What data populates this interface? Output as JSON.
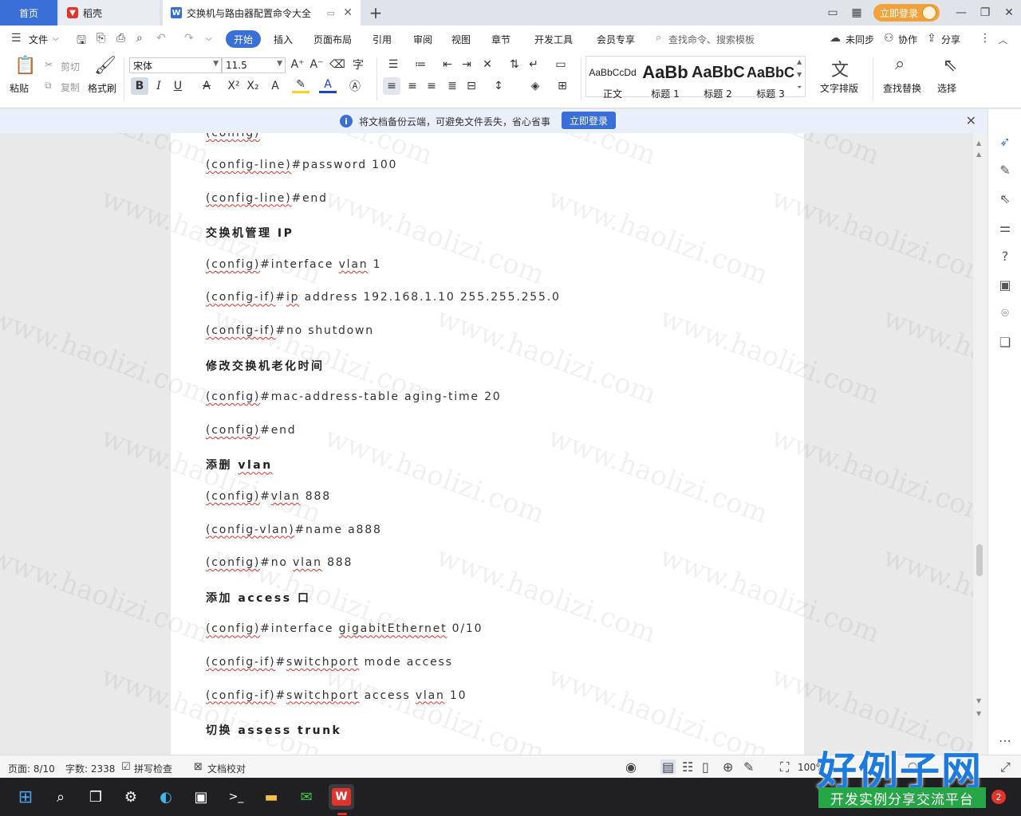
{
  "tabs": [
    {
      "label": "首页"
    },
    {
      "label": "稻壳"
    },
    {
      "label": "交换机与路由器配置命令大全"
    }
  ],
  "window": {
    "login_label": "立即登录"
  },
  "menu": {
    "file": "文件",
    "items": [
      "开始",
      "插入",
      "页面布局",
      "引用",
      "审阅",
      "视图",
      "章节",
      "开发工具",
      "会员专享"
    ],
    "search_placeholder": "查找命令、搜索模板",
    "unsynced": "未同步",
    "collab": "协作",
    "share": "分享"
  },
  "ribbon": {
    "paste": "粘贴",
    "cut": "剪切",
    "copy": "复制",
    "format_painter": "格式刷",
    "font_name": "宋体",
    "font_size": "11.5",
    "styles": [
      {
        "sample": "AaBbCcDd",
        "name": "正文"
      },
      {
        "sample": "AaBb",
        "name": "标题 1"
      },
      {
        "sample": "AaBbC",
        "name": "标题 2"
      },
      {
        "sample": "AaBbC",
        "name": "标题 3"
      }
    ],
    "text_layout": "文字排版",
    "find_replace": "查找替换",
    "select": "选择"
  },
  "notice": {
    "text": "将文档备份云端，可避免文件丢失，省心省事",
    "button": "立即登录"
  },
  "document": {
    "lines": [
      {
        "text": "(config-line)#password 100",
        "head": false
      },
      {
        "text": "(config-line)#end",
        "head": false
      },
      {
        "text": "交换机管理 IP",
        "head": true
      },
      {
        "text": "(config)#interface vlan 1",
        "head": false
      },
      {
        "text": "(config-if)#ip address 192.168.1.10 255.255.255.0",
        "head": false
      },
      {
        "text": "(config-if)#no shutdown",
        "head": false
      },
      {
        "text": "修改交换机老化时间",
        "head": true
      },
      {
        "text": "(config)#mac-address-table aging-time 20",
        "head": false
      },
      {
        "text": "(config)#end",
        "head": false
      },
      {
        "text": "添删 vlan",
        "head": true
      },
      {
        "text": "(config)#vlan 888",
        "head": false
      },
      {
        "text": "(config-vlan)#name a888",
        "head": false
      },
      {
        "text": "(config)#no vlan 888",
        "head": false
      },
      {
        "text": "添加 access 口",
        "head": true
      },
      {
        "text": "(config)#interface gigabitEthernet 0/10",
        "head": false
      },
      {
        "text": "(config-if)#switchport mode access",
        "head": false
      },
      {
        "text": "(config-if)#switchport access vlan 10",
        "head": false
      },
      {
        "text": "切换 assess trunk",
        "head": true
      }
    ],
    "watermark": "www.haolizi.com"
  },
  "status": {
    "page": "页面: 8/10",
    "words": "字数: 2338",
    "spellcheck": "拼写检查",
    "proofread": "文档校对",
    "zoom": "100%"
  },
  "overlay": {
    "brand_title": "好例子网",
    "brand_sub": "开发实例分享交流平台"
  },
  "taskbar": {
    "badge": "2"
  },
  "colors": {
    "accent": "#3a6fd8",
    "spell_underline": "#e0312b",
    "brand_green": "#26a646"
  }
}
